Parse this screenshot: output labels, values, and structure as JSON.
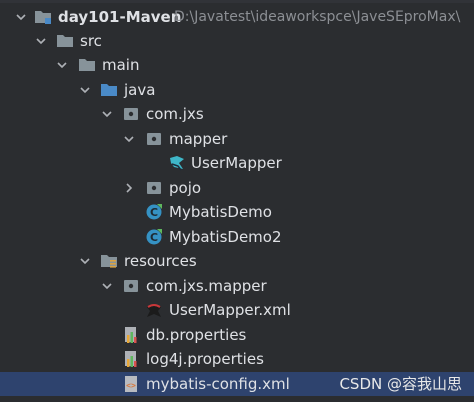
{
  "tree": {
    "project": {
      "name": "day101-Maven",
      "path": "D:\\Javatest\\ideaworkspce\\JaveSEproMax\\"
    },
    "items": [
      {
        "label": "src",
        "icon": "folder-icon"
      },
      {
        "label": "main",
        "icon": "folder-icon"
      },
      {
        "label": "java",
        "icon": "source-folder-icon"
      },
      {
        "label": "com.jxs",
        "icon": "package-icon"
      },
      {
        "label": "mapper",
        "icon": "package-icon"
      },
      {
        "label": "UserMapper",
        "icon": "mapper-interface-icon"
      },
      {
        "label": "pojo",
        "icon": "package-icon"
      },
      {
        "label": "MybatisDemo",
        "icon": "java-class-icon"
      },
      {
        "label": "MybatisDemo2",
        "icon": "java-class-icon"
      },
      {
        "label": "resources",
        "icon": "resources-folder-icon"
      },
      {
        "label": "com.jxs.mapper",
        "icon": "package-icon"
      },
      {
        "label": "UserMapper.xml",
        "icon": "mybatis-xml-icon"
      },
      {
        "label": "db.properties",
        "icon": "properties-file-icon"
      },
      {
        "label": "log4j.properties",
        "icon": "properties-file-icon"
      },
      {
        "label": "mybatis-config.xml",
        "icon": "xml-file-icon"
      }
    ]
  },
  "watermark": "CSDN @容我山思",
  "colors": {
    "background": "#2b2d30",
    "selection": "#2e436e",
    "folder": "#87939a",
    "source_folder": "#4a8ac7",
    "class": "#3592c4"
  }
}
